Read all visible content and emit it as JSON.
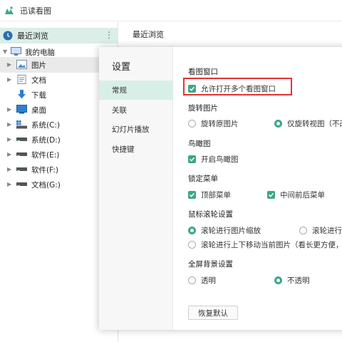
{
  "app": {
    "title": "迅读看图"
  },
  "sidebar": {
    "recent": {
      "label": "最近浏览",
      "more": "⋮"
    },
    "tree": [
      {
        "label": "我的电脑"
      },
      {
        "label": "图片"
      },
      {
        "label": "文档"
      },
      {
        "label": "下载"
      },
      {
        "label": "桌面"
      },
      {
        "label": "系统(C:)"
      },
      {
        "label": "系统(D:)"
      },
      {
        "label": "软件(E:)"
      },
      {
        "label": "软件(F:)"
      },
      {
        "label": "文档(G:)"
      }
    ]
  },
  "main": {
    "header": "最近浏览"
  },
  "settings": {
    "title": "设置",
    "nav": [
      {
        "label": "常规"
      },
      {
        "label": "关联"
      },
      {
        "label": "幻灯片播放"
      },
      {
        "label": "快捷键"
      }
    ],
    "sections": {
      "viewer_window": {
        "title": "看图窗口",
        "allow_multi": "允许打开多个看图窗口"
      },
      "rotate": {
        "title": "旋转图片",
        "rotate_original": "旋转原图片",
        "rotate_view_only": "仅旋转视图（不改"
      },
      "birdview": {
        "title": "鸟瞰图",
        "enable": "开启鸟瞰图"
      },
      "lock_menu": {
        "title": "锁定菜单",
        "top_menu": "顶部菜单",
        "middle_menu": "中间前后菜单"
      },
      "wheel": {
        "title": "鼠标滚轮设置",
        "zoom": "滚轮进行图片缩放",
        "scroll": "滚轮进行",
        "move": "滚轮进行上下移动当前图片（看长更方便，"
      },
      "fullscreen_bg": {
        "title": "全屏背景设置",
        "transparent": "透明",
        "opaque": "不透明"
      }
    },
    "reset_label": "恢复默认"
  },
  "colors": {
    "accent": "#3aa78a",
    "selection": "#dbeee8",
    "highlight_border": "#e23333"
  }
}
